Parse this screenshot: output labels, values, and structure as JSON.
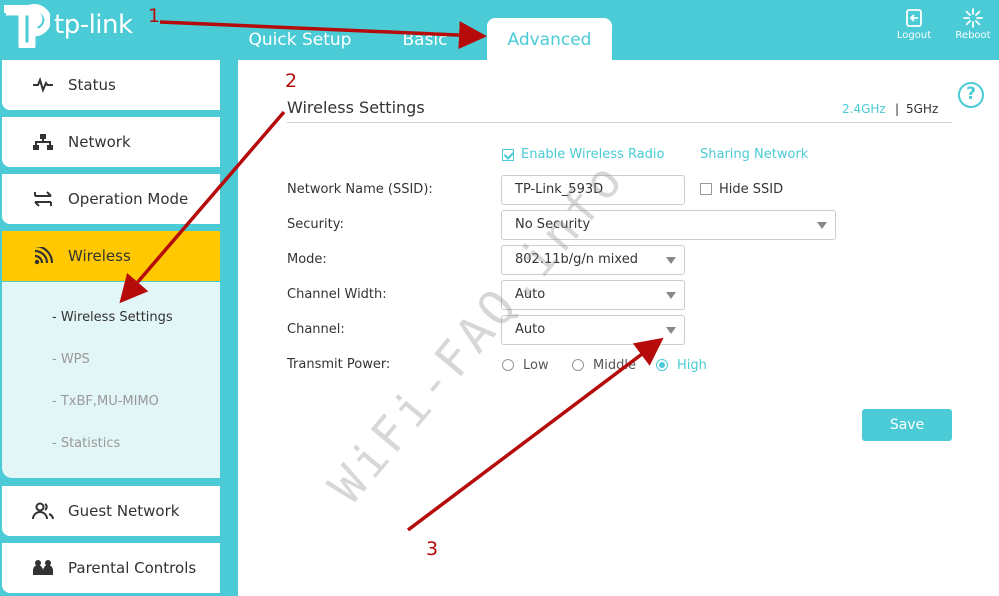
{
  "header": {
    "brand": "tp-link",
    "tabs": [
      {
        "label": "Quick Setup",
        "active": false
      },
      {
        "label": "Basic",
        "active": false
      },
      {
        "label": "Advanced",
        "active": true
      }
    ],
    "logout_label": "Logout",
    "reboot_label": "Reboot"
  },
  "sidebar": {
    "items": [
      {
        "label": "Status",
        "icon": "pulse-icon"
      },
      {
        "label": "Network",
        "icon": "network-icon"
      },
      {
        "label": "Operation Mode",
        "icon": "swap-icon"
      },
      {
        "label": "Wireless",
        "icon": "wifi-icon",
        "active": true
      },
      {
        "label": "Guest Network",
        "icon": "guests-icon"
      },
      {
        "label": "Parental Controls",
        "icon": "parental-icon"
      }
    ],
    "wireless_submenu": [
      {
        "label": "- Wireless Settings",
        "active": true
      },
      {
        "label": "- WPS"
      },
      {
        "label": "- TxBF,MU-MIMO"
      },
      {
        "label": "- Statistics"
      }
    ]
  },
  "main": {
    "title": "Wireless Settings",
    "band_24": "2.4GHz",
    "band_sep": "|",
    "band_5": "5GHz",
    "help_glyph": "?",
    "enable_radio_label": "Enable Wireless Radio",
    "enable_radio_checked": true,
    "sharing_network": "Sharing Network",
    "fields": {
      "ssid_label": "Network Name (SSID):",
      "ssid_value": "TP-Link_593D",
      "hide_ssid_label": "Hide SSID",
      "hide_ssid_checked": false,
      "security_label": "Security:",
      "security_value": "No Security",
      "mode_label": "Mode:",
      "mode_value": "802.11b/g/n mixed",
      "channel_width_label": "Channel Width:",
      "channel_width_value": "Auto",
      "channel_label": "Channel:",
      "channel_value": "Auto",
      "tx_power_label": "Transmit Power:",
      "tx_power_options": [
        "Low",
        "Middle",
        "High"
      ],
      "tx_power_selected": "High"
    },
    "save_label": "Save"
  },
  "watermark": "WiFi-FAQ.info",
  "annotations": [
    "1",
    "2",
    "3"
  ],
  "colors": {
    "accent": "#4acbd6",
    "active_menu": "#ffc800",
    "annotation": "#b50b0b"
  }
}
